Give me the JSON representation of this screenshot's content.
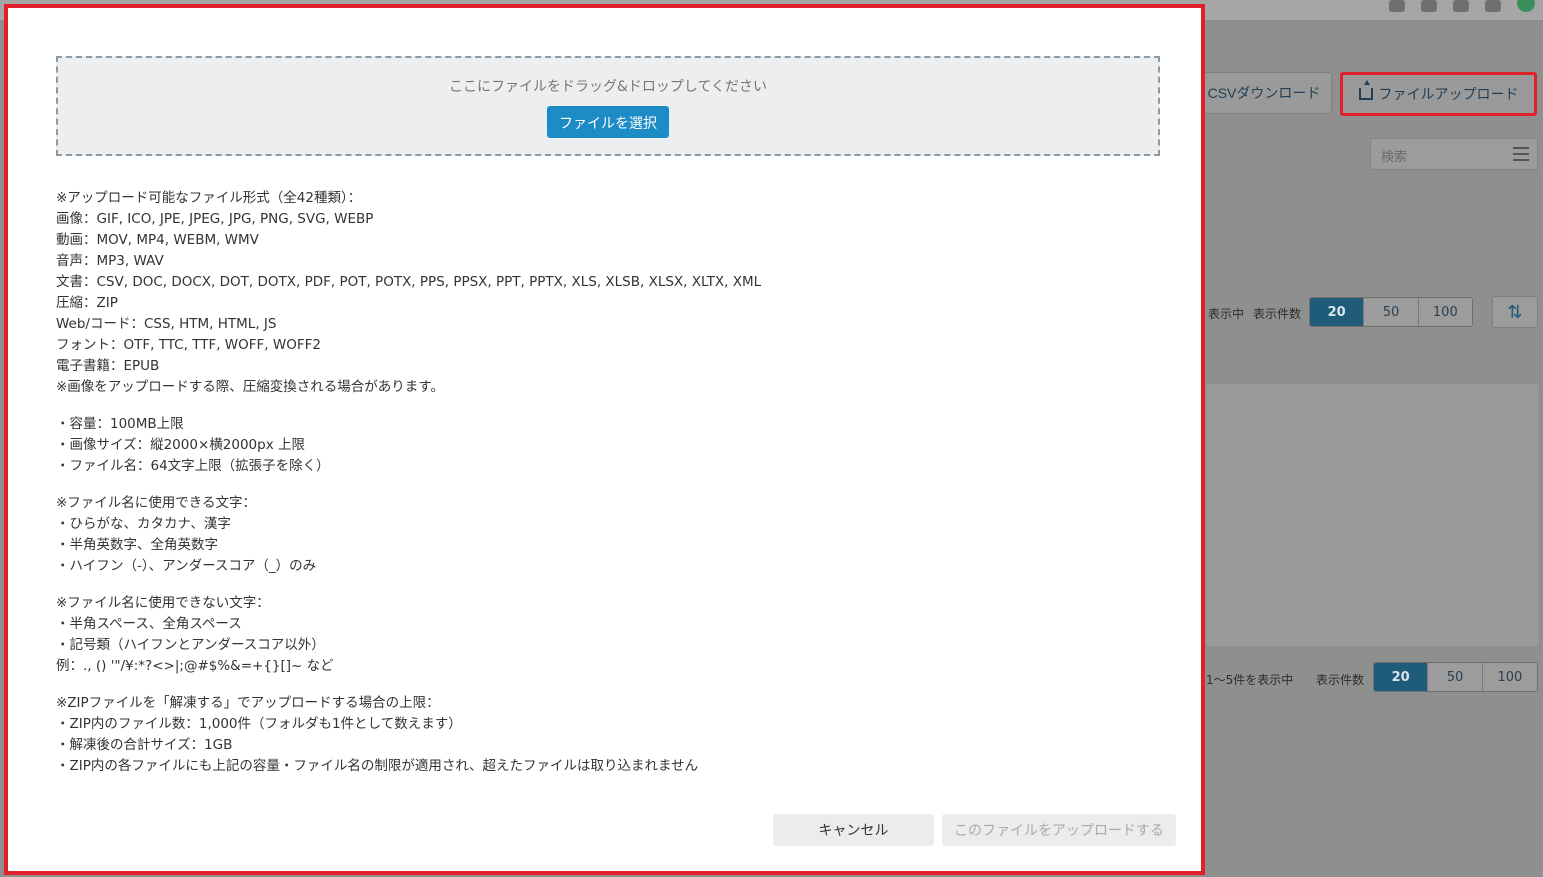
{
  "background": {
    "csv_download_label": "CSVダウンロード",
    "file_upload_label": "ファイルアップロード",
    "search_placeholder": "検索",
    "top_showing": "表示中",
    "page_size_label": "表示件数",
    "page_sizes": [
      "20",
      "50",
      "100"
    ],
    "bottom_showing": "1〜5件を表示中",
    "accent_color": "#1e5c7a",
    "highlight_color": "#e0202a"
  },
  "modal": {
    "dropzone_text": "ここにファイルをドラッグ&ドロップしてください",
    "select_file_label": "ファイルを選択",
    "info_sections": [
      [
        "※アップロード可能なファイル形式（全42種類）：",
        "画像：GIF, ICO, JPE, JPEG, JPG, PNG, SVG, WEBP",
        "動画：MOV, MP4, WEBM, WMV",
        "音声：MP3, WAV",
        "文書：CSV, DOC, DOCX, DOT, DOTX, PDF, POT, POTX, PPS, PPSX, PPT, PPTX, XLS, XLSB, XLSX, XLTX, XML",
        "圧縮：ZIP",
        "Web/コード：CSS, HTM, HTML, JS",
        "フォント：OTF, TTC, TTF, WOFF, WOFF2",
        "電子書籍：EPUB",
        "※画像をアップロードする際、圧縮変換される場合があります。"
      ],
      [
        "・容量：100MB上限",
        "・画像サイズ：縦2000×横2000px 上限",
        "・ファイル名：64文字上限（拡張子を除く）"
      ],
      [
        "※ファイル名に使用できる文字：",
        "・ひらがな、カタカナ、漢字",
        "・半角英数字、全角英数字",
        "・ハイフン（-）、アンダースコア（_）のみ"
      ],
      [
        "※ファイル名に使用できない文字：",
        "・半角スペース、全角スペース",
        "・記号類（ハイフンとアンダースコア以外）",
        "例：., () '\"/¥:*?<>|;@#$%&=+{}[]~ など"
      ],
      [
        "※ZIPファイルを「解凍する」でアップロードする場合の上限：",
        "・ZIP内のファイル数：1,000件（フォルダも1件として数えます）",
        "・解凍後の合計サイズ：1GB",
        "・ZIP内の各ファイルにも上記の容量・ファイル名の制限が適用され、超えたファイルは取り込まれません"
      ]
    ],
    "cancel_label": "キャンセル",
    "upload_label": "このファイルをアップロードする",
    "primary_color": "#1d8cc6"
  }
}
